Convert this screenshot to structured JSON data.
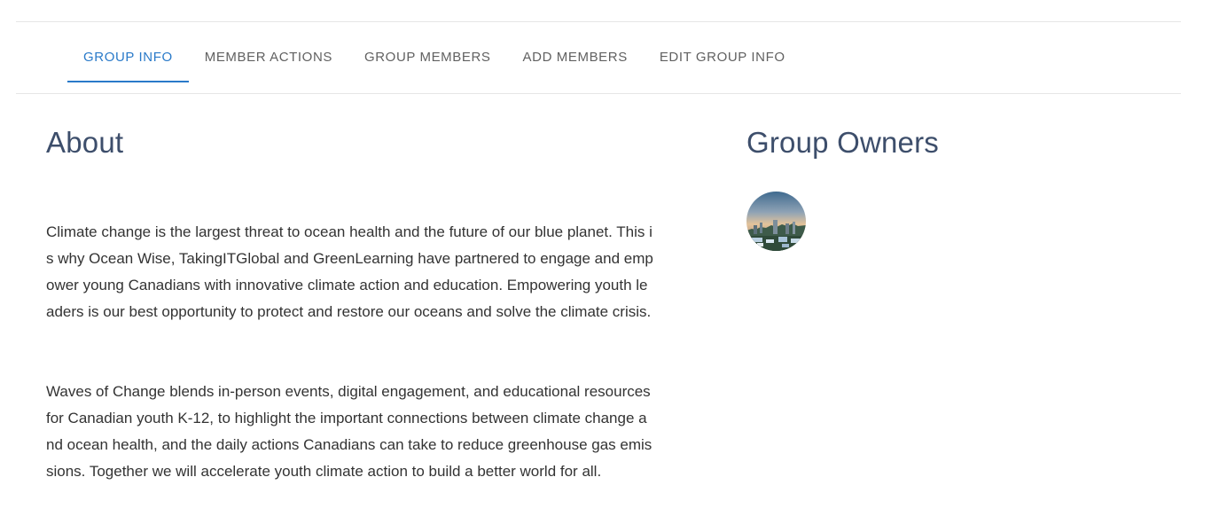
{
  "tabs": [
    {
      "label": "GROUP INFO",
      "active": true
    },
    {
      "label": "MEMBER ACTIONS",
      "active": false
    },
    {
      "label": "GROUP MEMBERS",
      "active": false
    },
    {
      "label": "ADD MEMBERS",
      "active": false
    },
    {
      "label": "EDIT GROUP INFO",
      "active": false
    }
  ],
  "about": {
    "heading": "About",
    "paragraphs": [
      "Climate change is the largest threat to ocean health and the future of our blue planet. This is why Ocean Wise, TakingITGlobal and GreenLearning have partnered to engage and empower young Canadians with innovative climate action and education. Empowering youth leaders is our best opportunity to protect and restore our oceans and solve the climate crisis.",
      "Waves of Change blends in-person events, digital engagement, and educational resources for Canadian youth K-12, to highlight the important connections between climate change and ocean health, and the daily actions Canadians can take to reduce greenhouse gas emissions. Together we will accelerate youth climate action to build a better world for all."
    ]
  },
  "owners": {
    "heading": "Group Owners",
    "avatars": [
      "city-skyline-sunset-avatar"
    ]
  },
  "colors": {
    "accent": "#2a7ac9",
    "heading": "#3d4e6b",
    "tab_text": "#616161",
    "body_text": "#333333",
    "divider": "#e6e6e6"
  }
}
